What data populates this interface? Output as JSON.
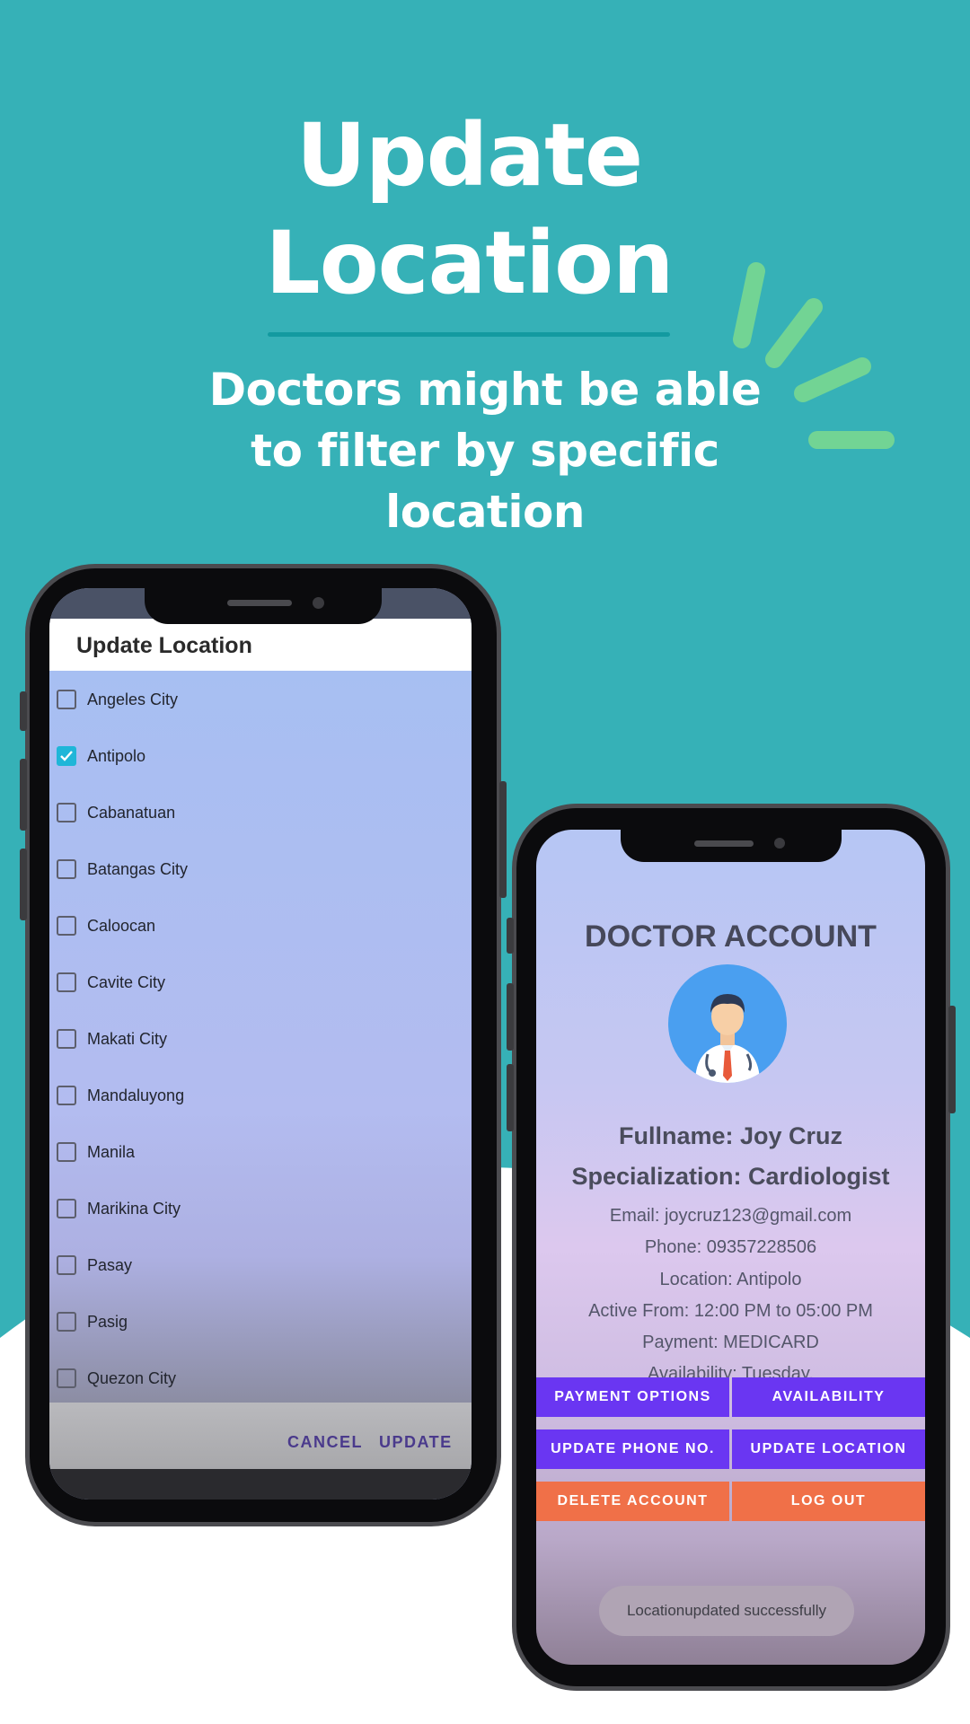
{
  "hero": {
    "title_line1": "Update",
    "title_line2": "Location",
    "subtitle_line1": "Doctors might be able",
    "subtitle_line2": "to filter by specific",
    "subtitle_line3": "location"
  },
  "colors": {
    "background_teal": "#36b1b7",
    "accent_green": "#72d494",
    "button_purple": "#6a36f2",
    "button_orange": "#f07048",
    "checkbox_checked": "#1fb6d8"
  },
  "left_phone": {
    "dialog_title": "Update Location",
    "locations": [
      {
        "label": "Angeles City",
        "checked": false
      },
      {
        "label": "Antipolo",
        "checked": true
      },
      {
        "label": "Cabanatuan",
        "checked": false
      },
      {
        "label": "Batangas City",
        "checked": false
      },
      {
        "label": "Caloocan",
        "checked": false
      },
      {
        "label": "Cavite City",
        "checked": false
      },
      {
        "label": "Makati City",
        "checked": false
      },
      {
        "label": "Mandaluyong",
        "checked": false
      },
      {
        "label": "Manila",
        "checked": false
      },
      {
        "label": "Marikina City",
        "checked": false
      },
      {
        "label": "Pasay",
        "checked": false
      },
      {
        "label": "Pasig",
        "checked": false
      },
      {
        "label": "Quezon City",
        "checked": false
      }
    ],
    "cancel_label": "CANCEL",
    "update_label": "UPDATE"
  },
  "right_phone": {
    "title": "DOCTOR ACCOUNT",
    "avatar_icon": "doctor-avatar-icon",
    "fullname": "Fullname: Joy Cruz",
    "specialization": "Specialization: Cardiologist",
    "email": "Email: joycruz123@gmail.com",
    "phone": "Phone: 09357228506",
    "location": "Location: Antipolo",
    "active_from": "Active From: 12:00 PM to 05:00 PM",
    "payment": "Payment: MEDICARD",
    "availability": "Availability: Tuesday,",
    "buttons": {
      "payment_options": "PAYMENT OPTIONS",
      "availability": "AVAILABILITY",
      "update_phone": "UPDATE PHONE NO.",
      "update_location": "UPDATE LOCATION",
      "delete_account": "DELETE ACCOUNT",
      "log_out": "LOG OUT"
    },
    "toast": "Locationupdated successfully"
  }
}
